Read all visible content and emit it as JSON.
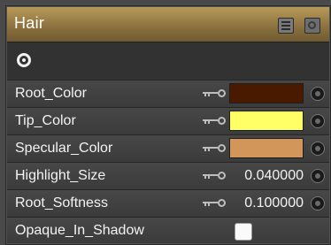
{
  "panel": {
    "title": "Hair",
    "header_icons": [
      "list-view-icon",
      "flat-view-icon"
    ],
    "toolbar_icon": "target-icon"
  },
  "properties": [
    {
      "label": "Root_Color",
      "kind": "color",
      "color": "#4a1a00"
    },
    {
      "label": "Tip_Color",
      "kind": "color",
      "color": "#ffff66"
    },
    {
      "label": "Specular_Color",
      "kind": "color",
      "color": "#d2955a"
    },
    {
      "label": "Highlight_Size",
      "kind": "number",
      "value": "0.040000"
    },
    {
      "label": "Root_Softness",
      "kind": "number",
      "value": "0.100000"
    },
    {
      "label": "Opaque_In_Shadow",
      "kind": "checkbox",
      "checked": false
    }
  ]
}
